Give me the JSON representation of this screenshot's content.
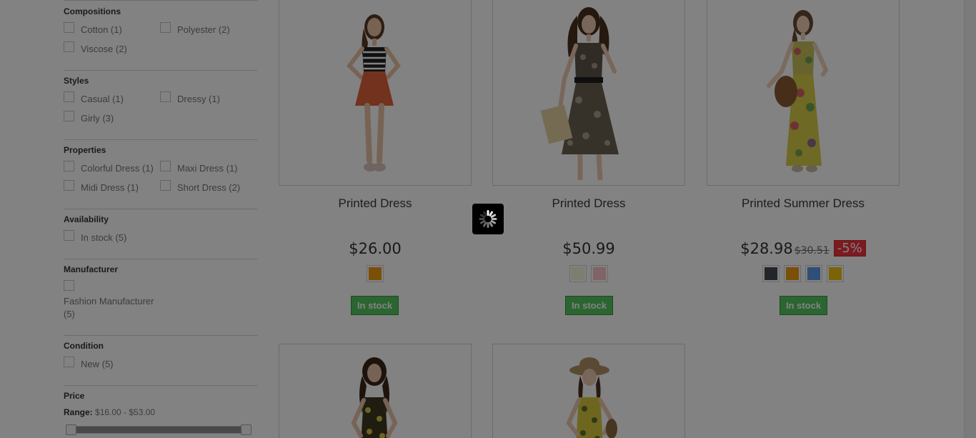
{
  "filters": {
    "compositions": {
      "title": "Compositions",
      "options": [
        {
          "label": "Cotton (1)"
        },
        {
          "label": "Polyester (2)"
        },
        {
          "label": "Viscose (2)"
        }
      ]
    },
    "styles": {
      "title": "Styles",
      "options": [
        {
          "label": "Casual (1)"
        },
        {
          "label": "Dressy (1)"
        },
        {
          "label": "Girly (3)"
        }
      ]
    },
    "properties": {
      "title": "Properties",
      "options": [
        {
          "label": "Colorful Dress (1)"
        },
        {
          "label": "Maxi Dress (1)"
        },
        {
          "label": "Midi Dress (1)"
        },
        {
          "label": "Short Dress (2)"
        }
      ]
    },
    "availability": {
      "title": "Availability",
      "options": [
        {
          "label": "In stock (5)"
        }
      ]
    },
    "manufacturer": {
      "title": "Manufacturer",
      "options": [
        {
          "label": "Fashion Manufacturer (5)"
        }
      ]
    },
    "condition": {
      "title": "Condition",
      "options": [
        {
          "label": "New (5)"
        }
      ]
    },
    "price": {
      "title": "Price",
      "range_label": "Range:",
      "range_value": "$16.00 - $53.00"
    }
  },
  "products": [
    {
      "name": "Printed Dress",
      "price": "$26.00",
      "old_price": "",
      "discount": "",
      "colors": [
        "#f39c11"
      ],
      "stock": "In stock",
      "illustration": "woman-striped-top-orange-skirt-icon"
    },
    {
      "name": "Printed Dress",
      "price": "$50.99",
      "old_price": "",
      "discount": "",
      "colors": [
        "#f5f5dc",
        "#fcc5c8"
      ],
      "stock": "In stock",
      "illustration": "woman-print-dress-icon"
    },
    {
      "name": "Printed Summer Dress",
      "price": "$28.98",
      "old_price": "$30.51",
      "discount": "-5%",
      "colors": [
        "#434a54",
        "#f39c11",
        "#5d9cec",
        "#f1c40f"
      ],
      "stock": "In stock",
      "illustration": "woman-floral-maxi-dress-icon"
    },
    {
      "illustration": "woman-floral-dress-icon"
    },
    {
      "illustration": "woman-sun-hat-dress-icon"
    }
  ],
  "overlay": {
    "loader_icon": "loading-spinner-icon"
  }
}
